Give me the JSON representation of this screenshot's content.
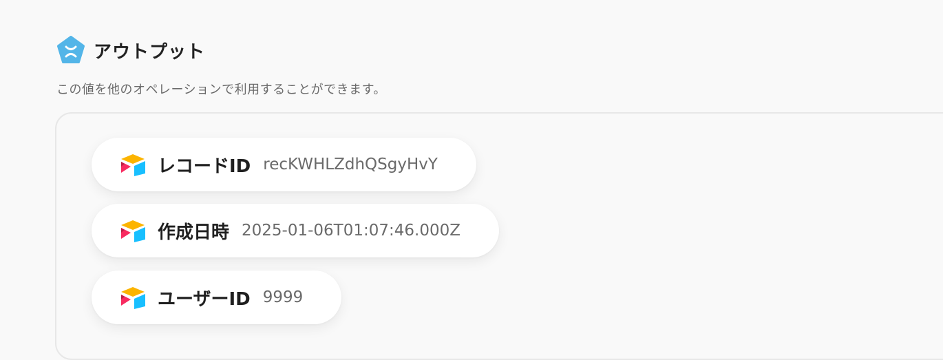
{
  "header": {
    "icon": "variable-x-pentagon-icon",
    "title": "アウトプット",
    "description": "この値を他のオペレーションで利用することができます。",
    "accent": "#53b5e8"
  },
  "outputs": [
    {
      "icon": "airtable-icon",
      "label": "レコードID",
      "value": "recKWHLZdhQSgyHvY"
    },
    {
      "icon": "airtable-icon",
      "label": "作成日時",
      "value": "2025-01-06T01:07:46.000Z"
    },
    {
      "icon": "airtable-icon",
      "label": "ユーザーID",
      "value": "9999"
    }
  ]
}
